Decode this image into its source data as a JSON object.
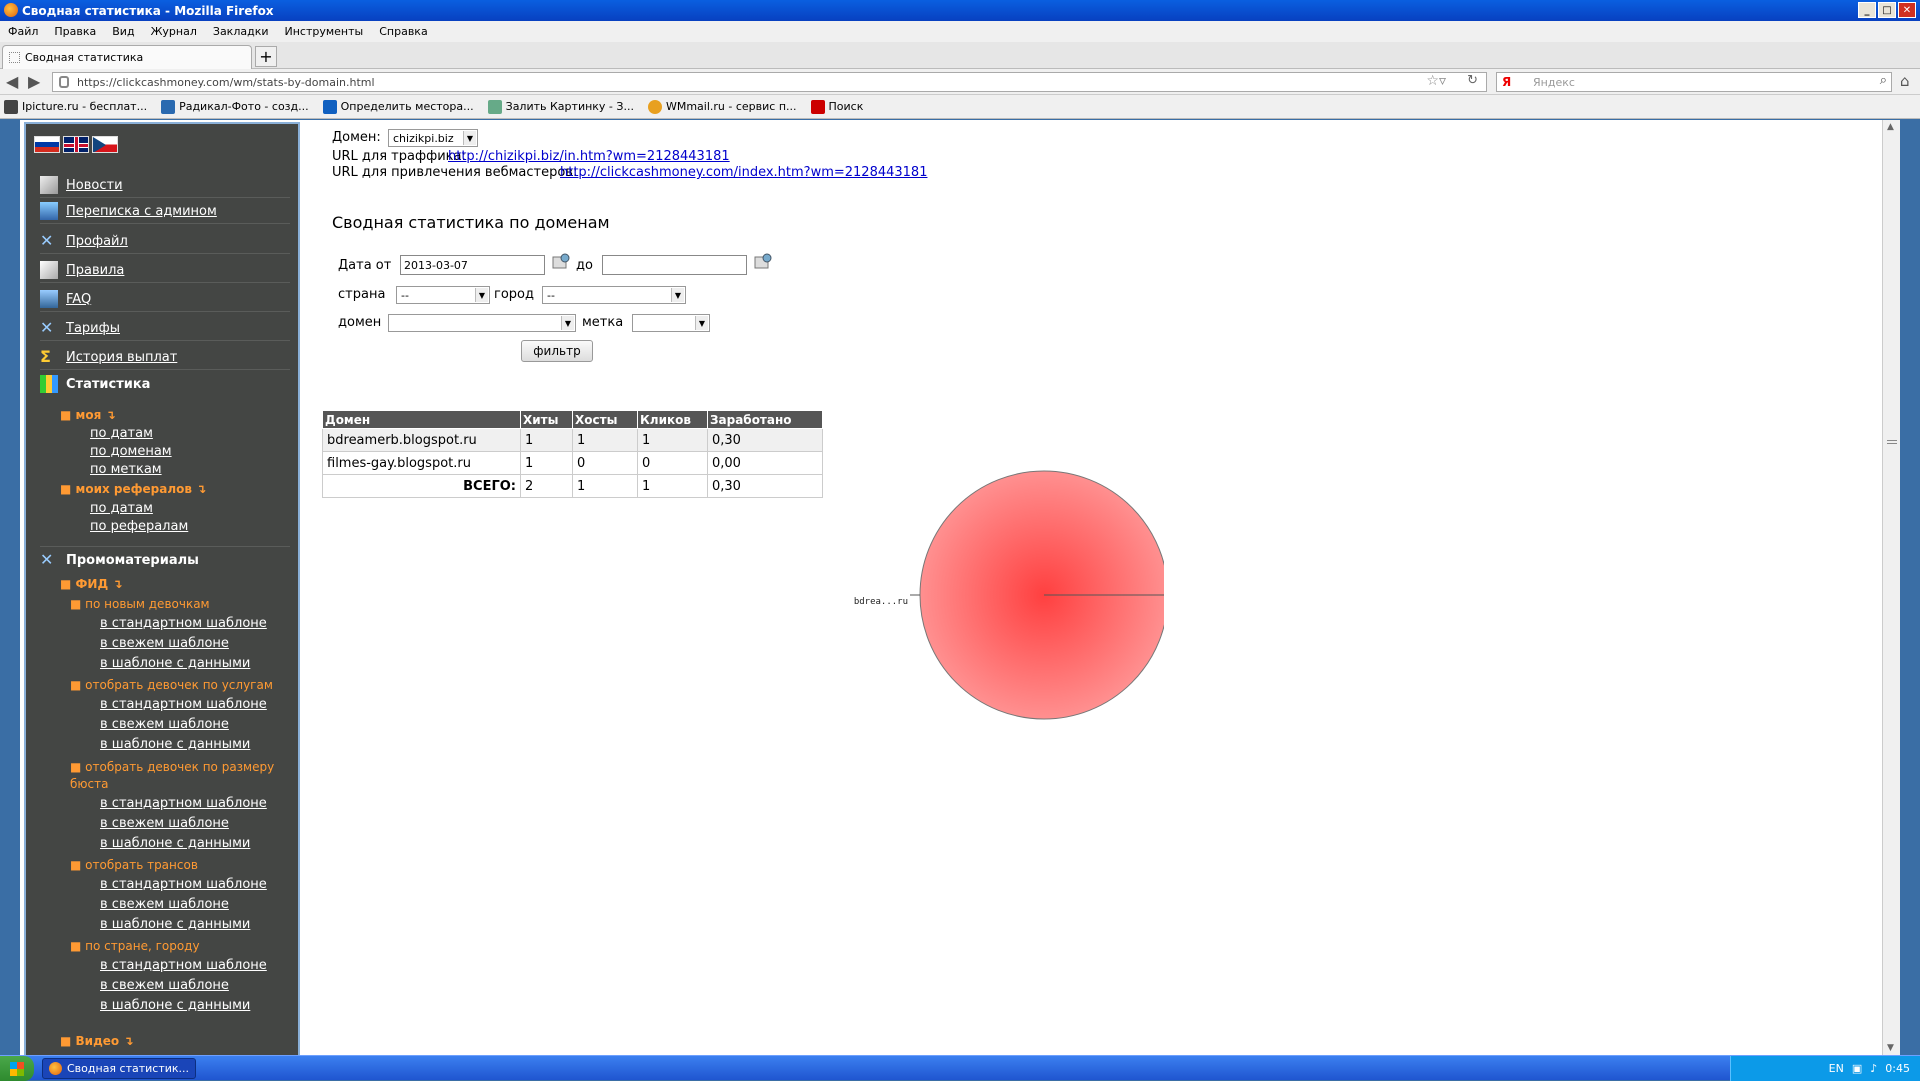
{
  "window": {
    "title": "Сводная статистика - Mozilla Firefox"
  },
  "menu": [
    "Файл",
    "Правка",
    "Вид",
    "Журнал",
    "Закладки",
    "Инструменты",
    "Справка"
  ],
  "tab": {
    "title": "Сводная статистика"
  },
  "url": "https://clickcashmoney.com/wm/stats-by-domain.html",
  "search": {
    "placeholder": "Яндекс",
    "engine": "Я"
  },
  "bookmarks": [
    "Ipicture.ru - бесплат...",
    "Радикал-Фото - созд...",
    "Определить местора...",
    "Залить Картинку - З...",
    "WMmail.ru - сервис п...",
    "Поиск"
  ],
  "sidebar": {
    "nav": [
      "Новости",
      "Переписка с админом",
      "Профайл",
      "Правила",
      "FAQ",
      "Тарифы",
      "История выплат"
    ],
    "stats_title": "Статистика",
    "my": "моя",
    "my_links": [
      "по датам",
      "по доменам",
      "по меткам"
    ],
    "refs": "моих рефералов",
    "refs_links": [
      "по датам",
      "по рефералам"
    ],
    "promo_title": "Промоматериалы",
    "feed": "ФИД",
    "groups": [
      {
        "title": "по новым девочкам",
        "links": [
          "в стандартном шаблоне",
          "в свежем шаблоне",
          "в шаблоне с данными"
        ]
      },
      {
        "title": "отобрать девочек по услугам",
        "links": [
          "в стандартном шаблоне",
          "в свежем шаблоне",
          "в шаблоне с данными"
        ]
      },
      {
        "title": "отобрать девочек по размеру бюста",
        "links": [
          "в стандартном шаблоне",
          "в свежем шаблоне",
          "в шаблоне с данными"
        ]
      },
      {
        "title": "отобрать трансов",
        "links": [
          "в стандартном шаблоне",
          "в свежем шаблоне",
          "в шаблоне с данными"
        ]
      },
      {
        "title": "по стране, городу",
        "links": [
          "в стандартном шаблоне",
          "в свежем шаблоне",
          "в шаблоне с данными"
        ]
      }
    ],
    "video": "Видео"
  },
  "main": {
    "domain_label": "Домен:",
    "domain_value": "chizikpi.biz",
    "traffic_label": "URL для траффика:",
    "traffic_url": "http://chizikpi.biz/in.htm?wm=2128443181",
    "webmaster_label": "URL для привлечения вебмастеров:",
    "webmaster_url": "http://clickcashmoney.com/index.htm?wm=2128443181",
    "heading": "Сводная статистика по доменам",
    "filter": {
      "date_from_label": "Дата от",
      "date_from": "2013-03-07",
      "date_to_label": "до",
      "date_to": "",
      "country_label": "страна",
      "country_value": "--",
      "city_label": "город",
      "city_value": "--",
      "domain_label": "домен",
      "domain_value": "",
      "tag_label": "метка",
      "tag_value": "",
      "button": "фильтр"
    },
    "table": {
      "headers": [
        "Домен",
        "Хиты",
        "Хосты",
        "Кликов",
        "Заработано"
      ],
      "rows": [
        [
          "bdreamerb.blogspot.ru",
          "1",
          "1",
          "1",
          "0,30"
        ],
        [
          "filmes-gay.blogspot.ru",
          "1",
          "0",
          "0",
          "0,00"
        ]
      ],
      "total": [
        "ВСЕГО:",
        "2",
        "1",
        "1",
        "0,30"
      ]
    }
  },
  "chart_data": {
    "type": "pie",
    "categories": [
      "bdrea...ru"
    ],
    "values": [
      100
    ],
    "colors": [
      "#ff4a4a"
    ]
  },
  "taskbar": {
    "task": "Сводная статистик...",
    "lang": "EN",
    "clock": "0:45"
  }
}
